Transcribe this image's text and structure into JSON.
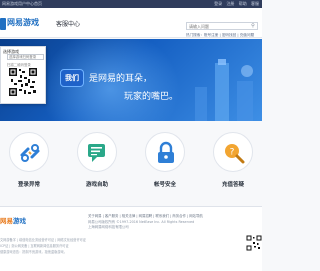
{
  "topbar": {
    "left_text": "网易游戏用户中心首页",
    "right_links": [
      "登录",
      "注册",
      "帮助",
      "客服"
    ]
  },
  "header": {
    "brand": "网易游戏",
    "section_title": "客服中心",
    "search_placeholder": "请输入问题",
    "search_icon": "search-icon",
    "hot_links": "热门搜索：账号注册 | 密码找回 | 充值问题"
  },
  "banner": {
    "badge": "我们",
    "slogan_line1": "是网易的耳朵，",
    "slogan_line2": "玩家的嘴巴。",
    "colors": {
      "primary": "#155fc2",
      "light": "#3e8fe5"
    }
  },
  "qr_popup": {
    "title": "选择游戏",
    "select_value": "选择游戏扫码登录",
    "hint": "扫描二维码登录"
  },
  "services": [
    {
      "label": "登录异常",
      "icon": "broken-link-icon"
    },
    {
      "label": "游戏自助",
      "icon": "chat-icon"
    },
    {
      "label": "帐号安全",
      "icon": "lock-icon"
    },
    {
      "label": "充值答疑",
      "icon": "magnifier-question-icon"
    }
  ],
  "footer": {
    "logo_orange": "网易",
    "logo_blue": "游戏",
    "links": "关于网易 | 客户服务 | 相关法律 | 网易招聘 | 联系我们 | 商务合作 | 网站导航",
    "copyright": "网易公司版权所有 ©1997-2016 NetEase Inc. All Rights Reserved",
    "company": "上海网易网络科技有限公司",
    "lines": [
      "文网游备字 | 增值电信业务经营许可证 | 网络文化经营许可证",
      "ICP证 | 浙公网安备 | 互联网新闻信息服务许可证",
      "健康游戏忠告：抵制不良游戏，拒绝盗版游戏。"
    ]
  }
}
